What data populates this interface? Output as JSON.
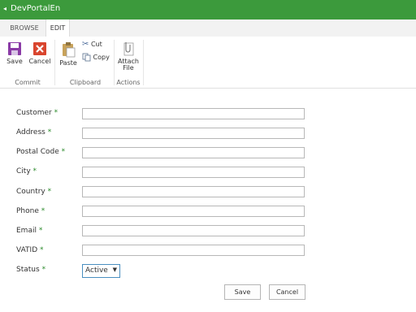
{
  "app": {
    "title": "DevPortalEn",
    "back_icon": "chevron-left-icon"
  },
  "tabs": [
    {
      "label": "BROWSE"
    },
    {
      "label": "EDIT"
    }
  ],
  "ribbon": {
    "save_label": "Save",
    "cancel_label": "Cancel",
    "paste_label": "Paste",
    "cut_label": "Cut",
    "copy_label": "Copy",
    "attach_label_1": "Attach",
    "attach_label_2": "File",
    "groups": {
      "commit": "Commit",
      "clipboard": "Clipboard",
      "actions": "Actions"
    }
  },
  "form": {
    "required_mark": "*",
    "fields": [
      {
        "label": "Customer",
        "value": ""
      },
      {
        "label": "Address",
        "value": ""
      },
      {
        "label": "Postal Code",
        "value": ""
      },
      {
        "label": "City",
        "value": ""
      },
      {
        "label": "Country",
        "value": ""
      },
      {
        "label": "Phone",
        "value": ""
      },
      {
        "label": "Email",
        "value": ""
      },
      {
        "label": "VATID",
        "value": ""
      }
    ],
    "status": {
      "label": "Status",
      "value": "Active"
    },
    "save_button": "Save",
    "cancel_button": "Cancel"
  },
  "colors": {
    "topbar": "#3c9a3c",
    "required": "#2a8a2a",
    "save_icon": "#8a3aa6",
    "cancel_icon": "#d9452e"
  }
}
